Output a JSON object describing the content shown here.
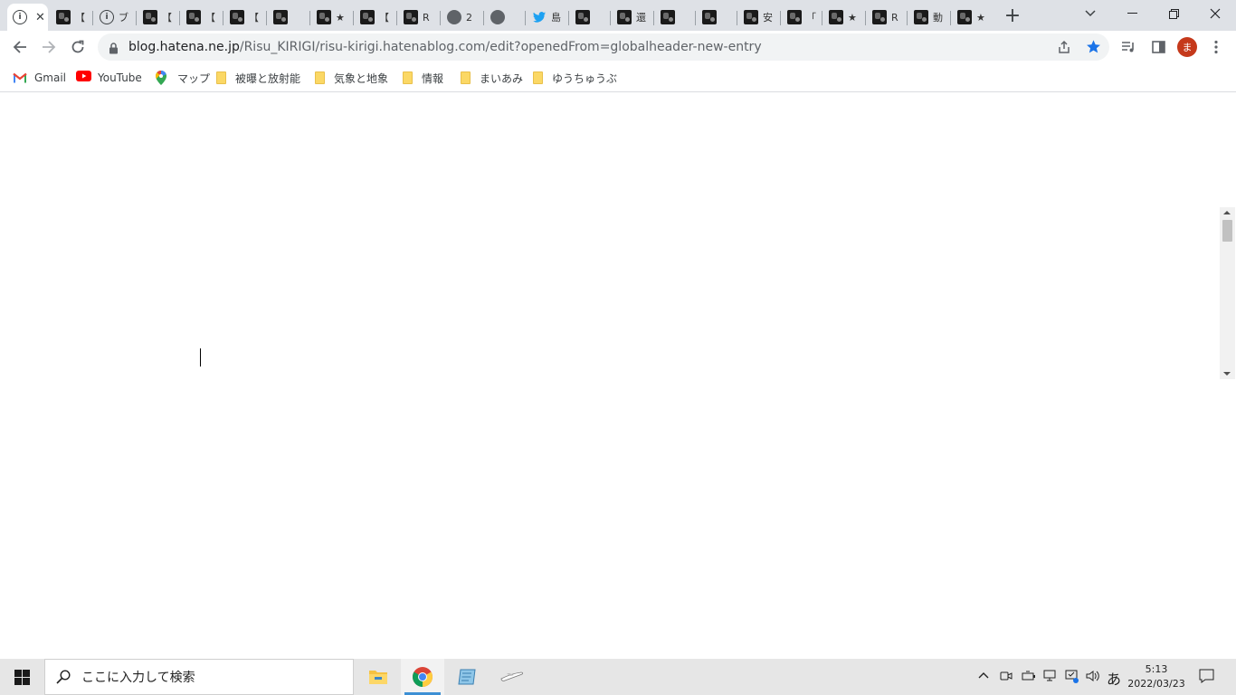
{
  "tabs": [
    {
      "label": "",
      "icon": "info-icon",
      "active": true
    },
    {
      "label": "【",
      "icon": "thumbnail-icon"
    },
    {
      "label": "ブ",
      "icon": "info-icon"
    },
    {
      "label": "【",
      "icon": "thumbnail-icon"
    },
    {
      "label": "【",
      "icon": "thumbnail-icon"
    },
    {
      "label": "【",
      "icon": "thumbnail-icon"
    },
    {
      "label": "",
      "icon": "thumbnail-icon"
    },
    {
      "label": "★",
      "icon": "thumbnail-icon"
    },
    {
      "label": "【",
      "icon": "thumbnail-icon"
    },
    {
      "label": "R",
      "icon": "thumbnail-icon"
    },
    {
      "label": "2",
      "icon": "globe-icon"
    },
    {
      "label": "",
      "icon": "globe-icon"
    },
    {
      "label": "島",
      "icon": "twitter-icon"
    },
    {
      "label": "",
      "icon": "thumbnail-icon"
    },
    {
      "label": "還",
      "icon": "thumbnail-icon"
    },
    {
      "label": "",
      "icon": "thumbnail-icon"
    },
    {
      "label": "",
      "icon": "thumbnail-icon"
    },
    {
      "label": "安",
      "icon": "thumbnail-icon"
    },
    {
      "label": "「",
      "icon": "thumbnail-icon"
    },
    {
      "label": "★",
      "icon": "thumbnail-icon"
    },
    {
      "label": "R",
      "icon": "thumbnail-icon"
    },
    {
      "label": "動",
      "icon": "thumbnail-icon"
    },
    {
      "label": "★",
      "icon": "thumbnail-icon"
    }
  ],
  "address": {
    "host": "blog.hatena.ne.jp",
    "path": "/Risu_KIRIGI/risu-kirigi.hatenablog.com/edit?openedFrom=globalheader-new-entry"
  },
  "profile_initial": "ま",
  "bookmarks": [
    {
      "label": "Gmail",
      "icon": "gmail-icon"
    },
    {
      "label": "YouTube",
      "icon": "youtube-icon"
    },
    {
      "label": "マップ",
      "icon": "maps-pin-icon"
    },
    {
      "label": "被曝と放射能",
      "icon": "folder-icon"
    },
    {
      "label": "気象と地象",
      "icon": "folder-icon"
    },
    {
      "label": "情報",
      "icon": "folder-icon"
    },
    {
      "label": "まいあみ",
      "icon": "folder-icon"
    },
    {
      "label": "ゆうちゅうぶ",
      "icon": "folder-icon"
    }
  ],
  "taskbar": {
    "search_placeholder": "ここに入力して検索",
    "ime": "あ",
    "time": "5:13",
    "date": "2022/03/23"
  },
  "colors": {
    "tabstrip_bg": "#dee1e6",
    "star_blue": "#1a73e8",
    "profile_bg": "#c5391b",
    "taskbar_bg": "#e6e6e6"
  }
}
